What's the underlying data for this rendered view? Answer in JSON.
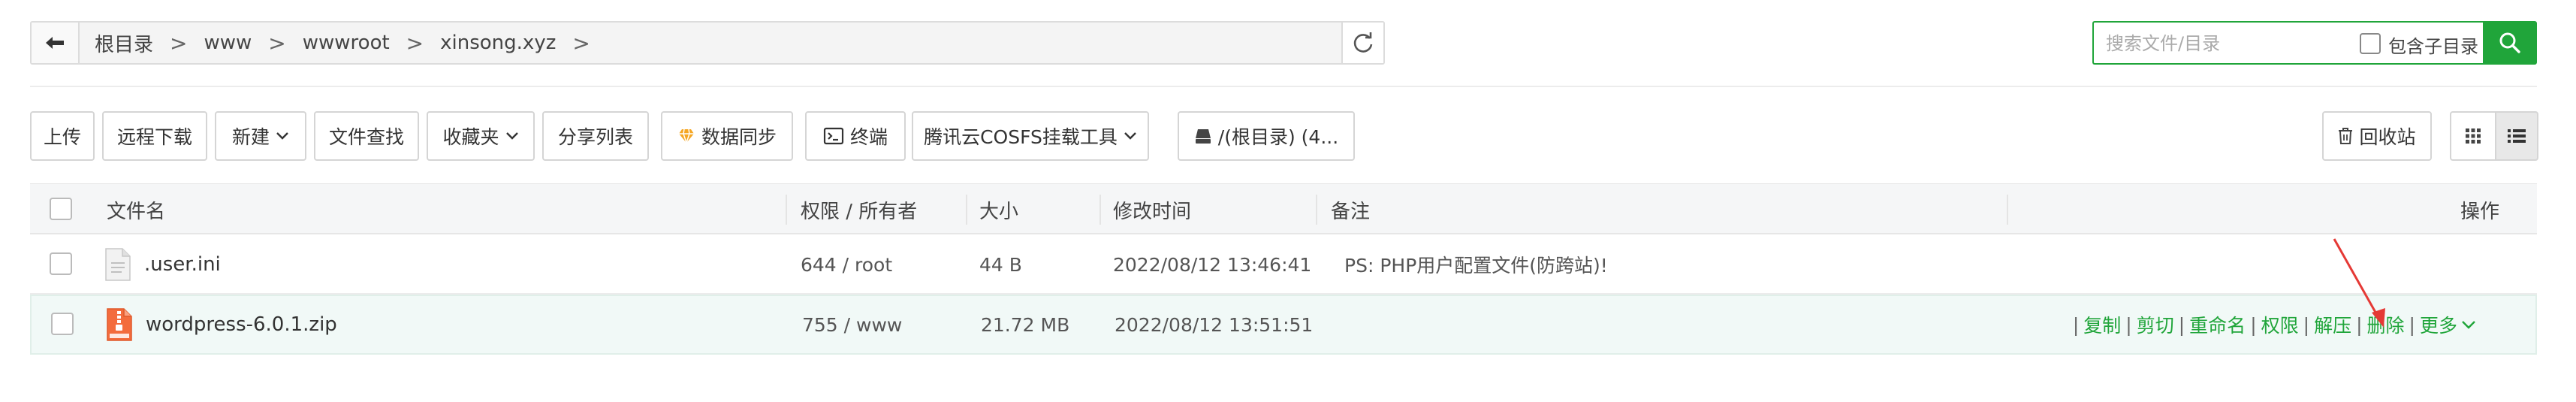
{
  "breadcrumb": {
    "items": [
      "根目录",
      "www",
      "wwwroot",
      "xinsong.xyz"
    ],
    "separator": ">"
  },
  "search": {
    "placeholder": "搜索文件/目录",
    "include_sub_label": "包含子目录"
  },
  "toolbar": {
    "upload": "上传",
    "remote_download": "远程下载",
    "new": "新建",
    "file_search": "文件查找",
    "favorites": "收藏夹",
    "share_list": "分享列表",
    "data_sync": "数据同步",
    "terminal": "终端",
    "cosfs": "腾讯云COSFS挂载工具",
    "disk": "/(根目录) (4...",
    "recycle_bin": "回收站"
  },
  "table": {
    "headers": {
      "name": "文件名",
      "perm": "权限 / 所有者",
      "size": "大小",
      "mtime": "修改时间",
      "note": "备注",
      "ops": "操作"
    },
    "rows": [
      {
        "name": ".user.ini",
        "perm": "644 / root",
        "size": "44 B",
        "mtime": "2022/08/12 13:46:41",
        "note": "PS: PHP用户配置文件(防跨站)!"
      },
      {
        "name": "wordpress-6.0.1.zip",
        "perm": "755 / www",
        "size": "21.72 MB",
        "mtime": "2022/08/12 13:51:51",
        "note": "",
        "ops": {
          "copy": "复制",
          "cut": "剪切",
          "rename": "重命名",
          "perm": "权限",
          "extract": "解压",
          "delete": "删除",
          "more": "更多"
        }
      }
    ]
  },
  "colors": {
    "accent": "#20a53a",
    "arrow": "#e53935"
  }
}
